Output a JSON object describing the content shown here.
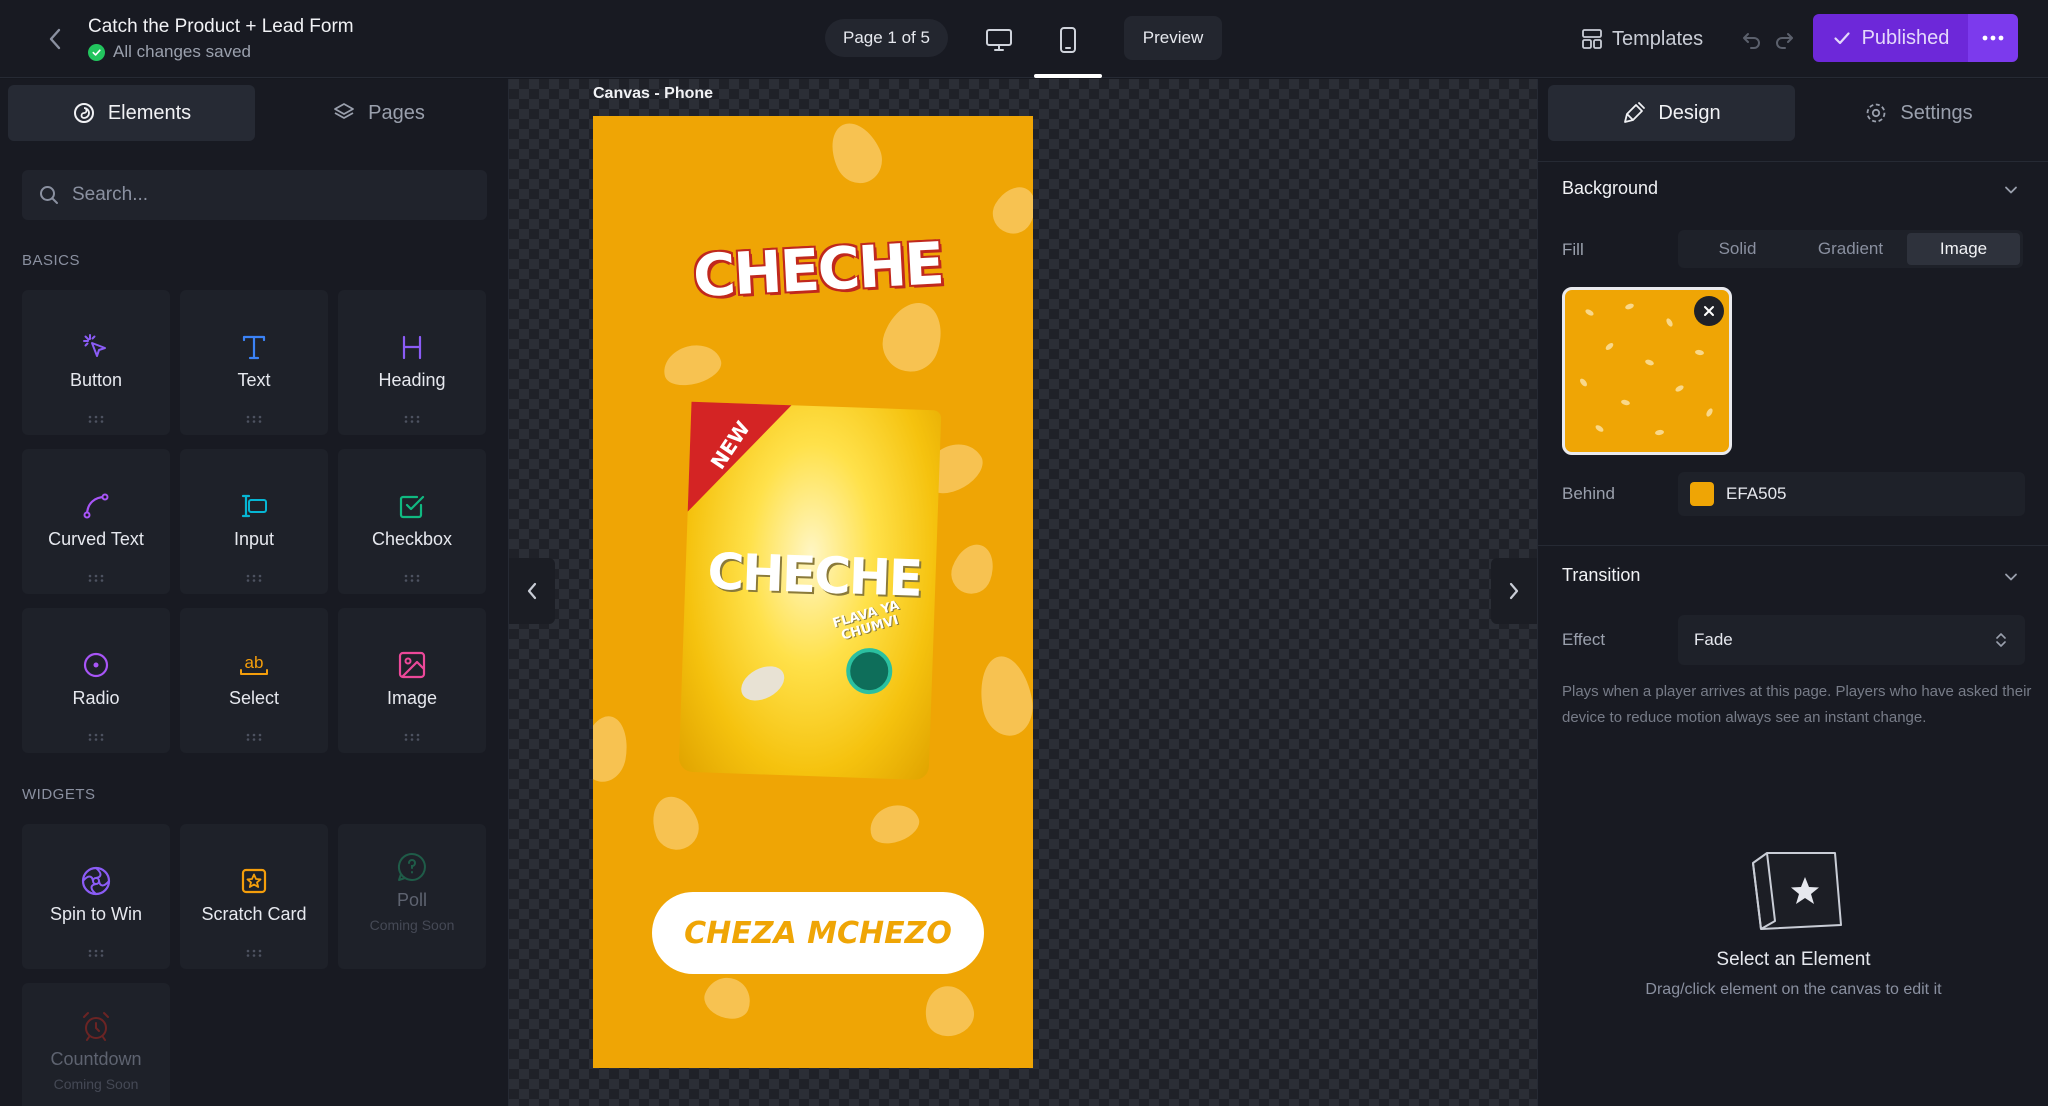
{
  "header": {
    "project_title": "Catch the Product + Lead Form",
    "save_status": "All changes saved",
    "page_indicator": "Page 1 of 5",
    "preview_label": "Preview",
    "templates_label": "Templates",
    "publish_label": "Published",
    "active_device": "phone"
  },
  "left_panel": {
    "tabs": [
      {
        "label": "Elements",
        "icon": "elements-icon",
        "active": true
      },
      {
        "label": "Pages",
        "icon": "layers-icon",
        "active": false
      }
    ],
    "search_placeholder": "Search...",
    "sections": [
      {
        "title": "BASICS",
        "items": [
          {
            "label": "Button",
            "icon": "pointer-click-icon",
            "color": "#8b5cf6"
          },
          {
            "label": "Text",
            "icon": "text-t-icon",
            "color": "#3b82f6"
          },
          {
            "label": "Heading",
            "icon": "heading-h-icon",
            "color": "#8b5cf6"
          },
          {
            "label": "Curved Text",
            "icon": "curve-icon",
            "color": "#a855f7"
          },
          {
            "label": "Input",
            "icon": "input-cursor-icon",
            "color": "#06b6d4"
          },
          {
            "label": "Checkbox",
            "icon": "checkbox-icon",
            "color": "#10b981"
          },
          {
            "label": "Radio",
            "icon": "radio-icon",
            "color": "#a855f7"
          },
          {
            "label": "Select",
            "icon": "select-ab-icon",
            "color": "#f59e0b"
          },
          {
            "label": "Image",
            "icon": "image-icon",
            "color": "#ec4899"
          }
        ]
      },
      {
        "title": "WIDGETS",
        "items": [
          {
            "label": "Spin to Win",
            "icon": "wheel-icon",
            "color": "#8b5cf6"
          },
          {
            "label": "Scratch Card",
            "icon": "star-card-icon",
            "color": "#f59e0b"
          },
          {
            "label": "Poll",
            "icon": "poll-chat-icon",
            "color": "#10b981",
            "subtitle": "Coming Soon"
          },
          {
            "label": "Countdown",
            "icon": "alarm-clock-icon",
            "color": "#ef4444",
            "subtitle": "Coming Soon"
          }
        ]
      }
    ]
  },
  "canvas": {
    "label": "Canvas - Phone",
    "background_color": "#EFA505",
    "brand_logo": "CHECHE",
    "bag_badge": "NEW",
    "bag_tagline": "FLAVA YA\nCHUMVI",
    "cta_label": "CHEZA MCHEZO"
  },
  "right_panel": {
    "tabs": [
      {
        "label": "Design",
        "icon": "brush-icon",
        "active": true
      },
      {
        "label": "Settings",
        "icon": "gear-icon",
        "active": false
      }
    ],
    "background": {
      "title": "Background",
      "fill_label": "Fill",
      "fill_options": [
        "Solid",
        "Gradient",
        "Image"
      ],
      "fill_selected": "Image",
      "behind_label": "Behind",
      "behind_color": "EFA505",
      "behind_swatch": "#EFA505"
    },
    "transition": {
      "title": "Transition",
      "effect_label": "Effect",
      "effect_value": "Fade",
      "help": "Plays when a player arrives at this page. Players who have asked their device to reduce motion always see an instant change."
    },
    "empty_state": {
      "title": "Select an Element",
      "subtitle": "Drag/click element on the canvas to edit it",
      "icon": "element-star-icon"
    }
  }
}
